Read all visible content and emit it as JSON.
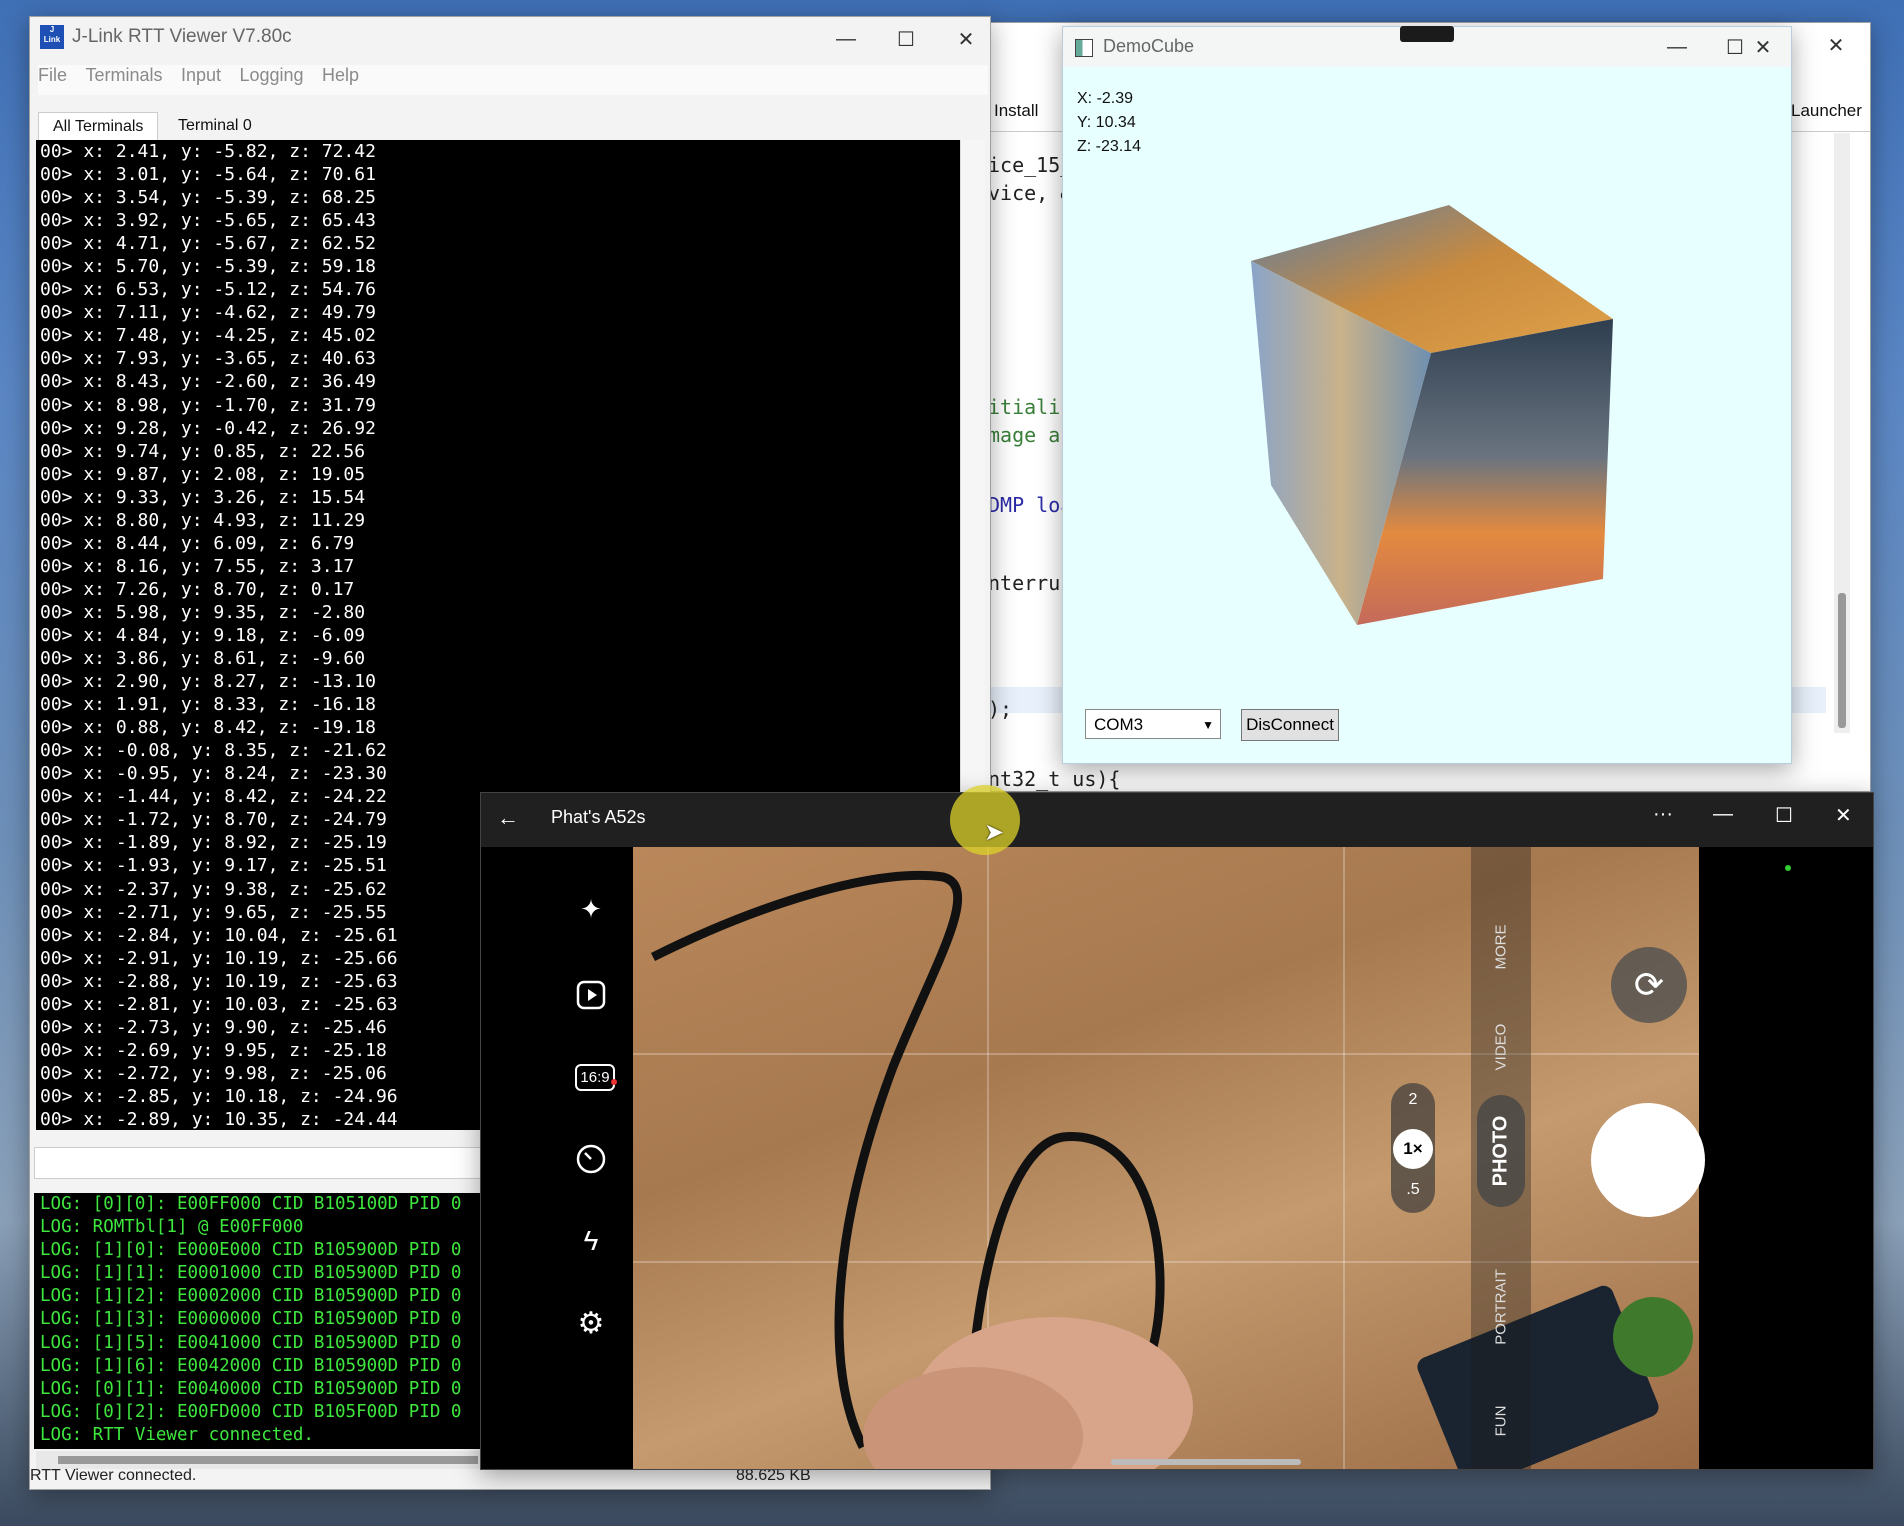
{
  "jlink": {
    "title": "J-Link RTT Viewer V7.80c",
    "app_icon_text": "J\nLink",
    "menu": [
      "File",
      "Terminals",
      "Input",
      "Logging",
      "Help"
    ],
    "tabs": [
      "All Terminals",
      "Terminal 0"
    ],
    "terminal_lines": [
      "00> x: 2.41, y: -5.82, z: 72.42",
      "00> x: 3.01, y: -5.64, z: 70.61",
      "00> x: 3.54, y: -5.39, z: 68.25",
      "00> x: 3.92, y: -5.65, z: 65.43",
      "00> x: 4.71, y: -5.67, z: 62.52",
      "00> x: 5.70, y: -5.39, z: 59.18",
      "00> x: 6.53, y: -5.12, z: 54.76",
      "00> x: 7.11, y: -4.62, z: 49.79",
      "00> x: 7.48, y: -4.25, z: 45.02",
      "00> x: 7.93, y: -3.65, z: 40.63",
      "00> x: 8.43, y: -2.60, z: 36.49",
      "00> x: 8.98, y: -1.70, z: 31.79",
      "00> x: 9.28, y: -0.42, z: 26.92",
      "00> x: 9.74, y: 0.85, z: 22.56",
      "00> x: 9.87, y: 2.08, z: 19.05",
      "00> x: 9.33, y: 3.26, z: 15.54",
      "00> x: 8.80, y: 4.93, z: 11.29",
      "00> x: 8.44, y: 6.09, z: 6.79",
      "00> x: 8.16, y: 7.55, z: 3.17",
      "00> x: 7.26, y: 8.70, z: 0.17",
      "00> x: 5.98, y: 9.35, z: -2.80",
      "00> x: 4.84, y: 9.18, z: -6.09",
      "00> x: 3.86, y: 8.61, z: -9.60",
      "00> x: 2.90, y: 8.27, z: -13.10",
      "00> x: 1.91, y: 8.33, z: -16.18",
      "00> x: 0.88, y: 8.42, z: -19.18",
      "00> x: -0.08, y: 8.35, z: -21.62",
      "00> x: -0.95, y: 8.24, z: -23.30",
      "00> x: -1.44, y: 8.42, z: -24.22",
      "00> x: -1.72, y: 8.70, z: -24.79",
      "00> x: -1.89, y: 8.92, z: -25.19",
      "00> x: -1.93, y: 9.17, z: -25.51",
      "00> x: -2.37, y: 9.38, z: -25.62",
      "00> x: -2.71, y: 9.65, z: -25.55",
      "00> x: -2.84, y: 10.04, z: -25.61",
      "00> x: -2.91, y: 10.19, z: -25.66",
      "00> x: -2.88, y: 10.19, z: -25.63",
      "00> x: -2.81, y: 10.03, z: -25.63",
      "00> x: -2.73, y: 9.90, z: -25.46",
      "00> x: -2.69, y: 9.95, z: -25.18",
      "00> x: -2.72, y: 9.98, z: -25.06",
      "00> x: -2.85, y: 10.18, z: -24.96",
      "00> x: -2.89, y: 10.35, z: -24.44"
    ],
    "log_lines": [
      "LOG: [0][0]: E00FF000 CID B105100D PID 0",
      "LOG: ROMTbl[1] @ E00FF000",
      "LOG: [1][0]: E000E000 CID B105900D PID 0",
      "LOG: [1][1]: E0001000 CID B105900D PID 0",
      "LOG: [1][2]: E0002000 CID B105900D PID 0",
      "LOG: [1][3]: E0000000 CID B105900D PID 0",
      "LOG: [1][5]: E0041000 CID B105900D PID 0",
      "LOG: [1][6]: E0042000 CID B105900D PID 0",
      "LOG: [0][1]: E0040000 CID B105900D PID 0",
      "LOG: [0][2]: E00FD000 CID B105F00D PID 0",
      "LOG: RTT Viewer connected."
    ],
    "status_left": "RTT Viewer connected.",
    "status_size": "88.625 KB"
  },
  "editor": {
    "tab_install": "Install",
    "tab_launcher": "Launcher",
    "code_lines": [
      {
        "text": "ice_15_",
        "color": "#222"
      },
      {
        "text": "vice, &",
        "color": "#222"
      },
      {
        "text": "itializ",
        "color": "#3a7f3a"
      },
      {
        "text": "mage ar",
        "color": "#3a7f3a"
      },
      {
        "text": "DMP loa",
        "color": "#2a2aa8"
      },
      {
        "text": "nterrup",
        "color": "#222"
      },
      {
        "text": ");",
        "color": "#222"
      },
      {
        "text": "nt32_t us){",
        "color": "#222"
      }
    ]
  },
  "democube": {
    "title": "DemoCube",
    "x": "X: -2.39",
    "y": "Y: 10.34",
    "z": "Z: -23.14",
    "port": "COM3",
    "button": "DisConnect"
  },
  "phone": {
    "title": "Phat's A52s",
    "more_dots": "···",
    "modes": [
      "MORE",
      "VIDEO",
      "PHOTO",
      "PORTRAIT",
      "FUN"
    ],
    "zoom": [
      "2",
      "1×",
      ".5"
    ],
    "aspect": "16:9"
  }
}
